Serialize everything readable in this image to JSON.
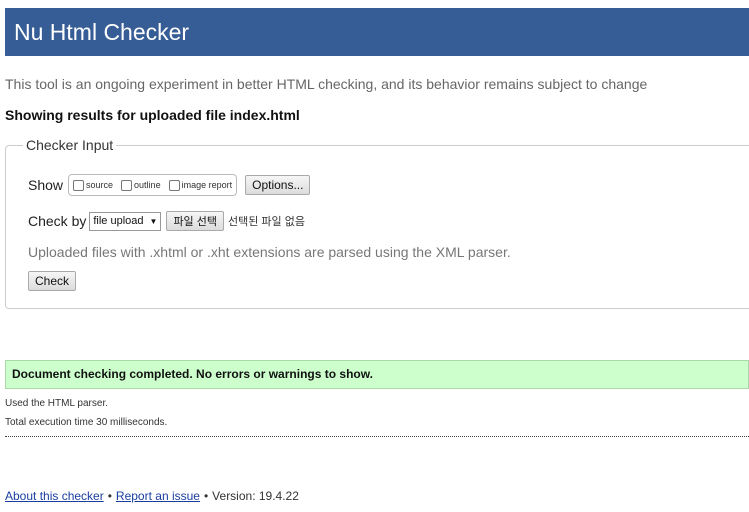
{
  "header": {
    "title": "Nu Html Checker"
  },
  "intro_text": "This tool is an ongoing experiment in better HTML checking, and its behavior remains subject to change",
  "showing_text": "Showing results for uploaded file index.html",
  "checker_input": {
    "legend": "Checker Input",
    "show_label": "Show",
    "show_options": [
      {
        "label": "source",
        "checked": false
      },
      {
        "label": "outline",
        "checked": false
      },
      {
        "label": "image report",
        "checked": false
      }
    ],
    "options_button": "Options...",
    "check_by_label": "Check by",
    "check_by_value": "file upload",
    "file_button": "파일 선택",
    "no_file_text": "선택된 파일 없음",
    "note": "Uploaded files with .xhtml or .xht extensions are parsed using the XML parser.",
    "check_button": "Check"
  },
  "result": {
    "success_message": "Document checking completed. No errors or warnings to show.",
    "parser_info": "Used the HTML parser.",
    "execution_time": "Total execution time 30 milliseconds."
  },
  "footer": {
    "about_link": "About this checker",
    "report_link": "Report an issue",
    "version_text": "Version: 19.4.22"
  },
  "colors": {
    "header_bg": "#365d95",
    "success_bg": "#ccffcc",
    "link": "#1a3ea0"
  }
}
